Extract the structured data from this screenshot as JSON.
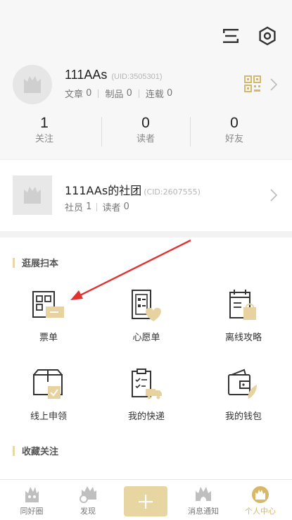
{
  "profile": {
    "name": "111AAs",
    "uid": "(UID:3505301)",
    "stats": [
      {
        "label": "文章",
        "value": "0"
      },
      {
        "label": "制品",
        "value": "0"
      },
      {
        "label": "连载",
        "value": "0"
      }
    ],
    "counts": [
      {
        "num": "1",
        "label": "关注"
      },
      {
        "num": "0",
        "label": "读者"
      },
      {
        "num": "0",
        "label": "好友"
      }
    ]
  },
  "club": {
    "name": "111AAs的社团",
    "cid": "(CID:2607555)",
    "stats": [
      {
        "label": "社员",
        "value": "1"
      },
      {
        "label": "读者",
        "value": "0"
      }
    ]
  },
  "sections": {
    "expo": {
      "title": "逛展扫本",
      "items": [
        {
          "label": "票单",
          "icon": "ticket-icon"
        },
        {
          "label": "心愿单",
          "icon": "wishlist-icon"
        },
        {
          "label": "离线攻略",
          "icon": "offline-guide-icon"
        },
        {
          "label": "线上申领",
          "icon": "online-claim-icon"
        },
        {
          "label": "我的快递",
          "icon": "delivery-icon"
        },
        {
          "label": "我的钱包",
          "icon": "wallet-icon"
        }
      ]
    },
    "favorites": {
      "title": "收藏关注"
    }
  },
  "tabbar": {
    "tabs": [
      {
        "label": "同好圈",
        "icon": "circle-icon"
      },
      {
        "label": "发现",
        "icon": "discover-icon"
      },
      {
        "label": "消息通知",
        "icon": "notification-icon"
      },
      {
        "label": "个人中心",
        "icon": "profile-icon"
      }
    ],
    "active": "个人中心"
  },
  "colors": {
    "accent": "#d8b766",
    "accent_light": "#e8d6a2",
    "annotation_arrow": "#e53030"
  }
}
